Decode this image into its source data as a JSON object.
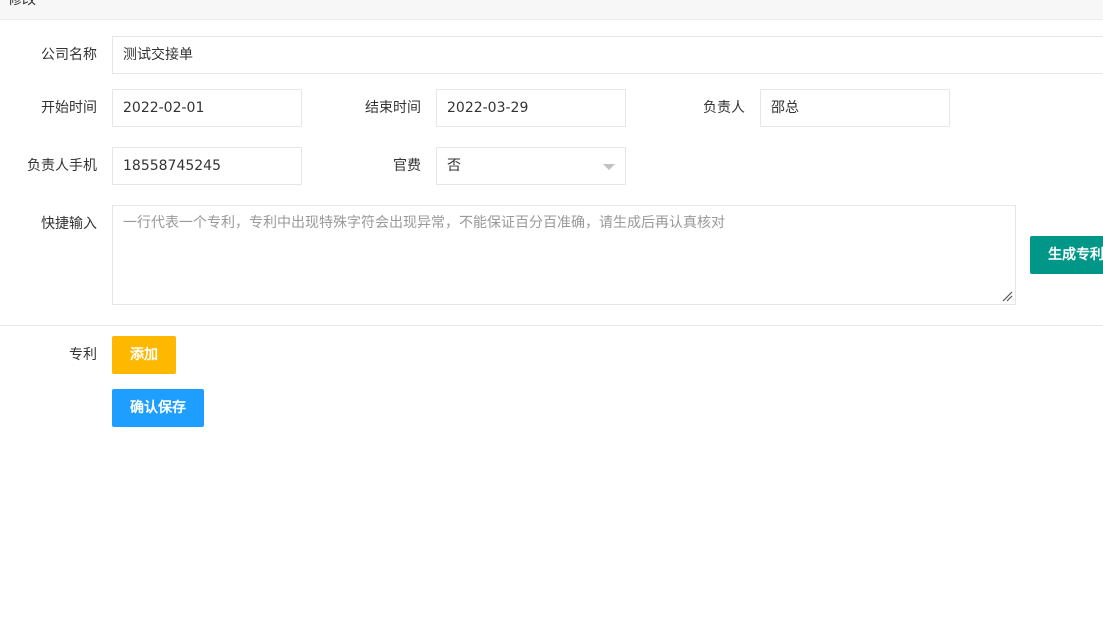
{
  "header": {
    "title": "修改"
  },
  "form": {
    "company_label": "公司名称",
    "company_value": "测试交接单",
    "start_label": "开始时间",
    "start_value": "2022-02-01",
    "end_label": "结束时间",
    "end_value": "2022-03-29",
    "owner_label": "负责人",
    "owner_value": "邵总",
    "phone_label": "负责人手机",
    "phone_value": "18558745245",
    "fee_label": "官费",
    "fee_value": "否",
    "quick_label": "快捷输入",
    "quick_placeholder": "一行代表一个专利，专利中出现特殊字符会出现异常，不能保证百分百准确，请生成后再认真核对",
    "generate_label": "生成专利",
    "patent_label": "专利",
    "add_label": "添加",
    "save_label": "确认保存"
  },
  "colors": {
    "generate": "#009688",
    "add": "#ffb800",
    "save": "#1e9fff"
  }
}
